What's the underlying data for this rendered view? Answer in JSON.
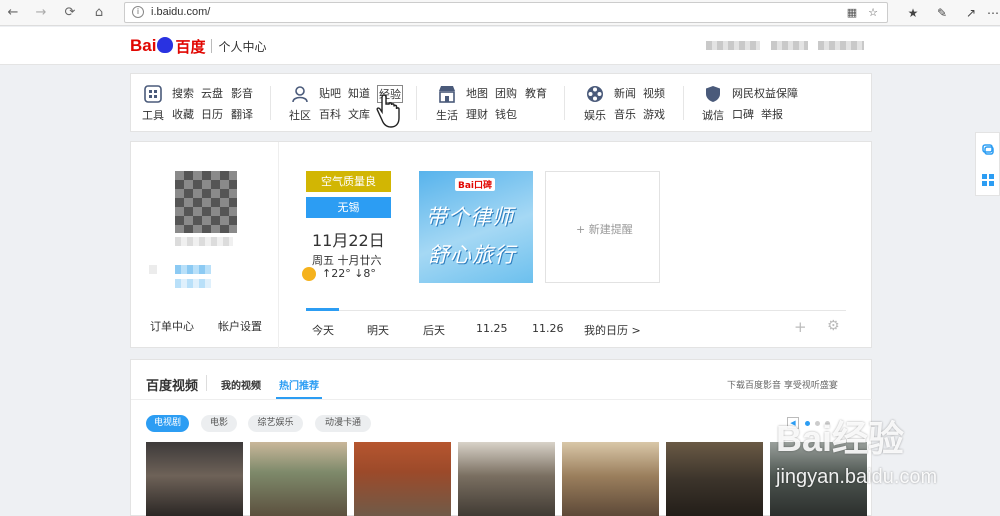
{
  "browser": {
    "url": "i.baidu.com/",
    "icons": [
      "back-icon",
      "forward-icon",
      "refresh-icon",
      "home-icon",
      "info-icon",
      "reading-view-icon",
      "favorite-star-icon",
      "favorites-hub-icon",
      "pen-icon",
      "share-icon",
      "more-icon"
    ]
  },
  "header": {
    "logo_bai": "Bai",
    "logo_du": "du",
    "logo_cn": "百度",
    "subtitle": "个人中心"
  },
  "nav": {
    "groups": [
      {
        "label": "工具",
        "icon": "tools-grid-icon",
        "links": [
          [
            "搜索",
            "云盘",
            "影音"
          ],
          [
            "收藏",
            "日历",
            "翻译"
          ]
        ]
      },
      {
        "label": "社区",
        "icon": "user-community-icon",
        "links": [
          [
            "贴吧",
            "知道",
            "经验"
          ],
          [
            "百科",
            "文库"
          ]
        ]
      },
      {
        "label": "生活",
        "icon": "store-icon",
        "links": [
          [
            "地图",
            "团购",
            "教育"
          ],
          [
            "理财",
            "钱包"
          ]
        ]
      },
      {
        "label": "娱乐",
        "icon": "film-reel-icon",
        "links": [
          [
            "新闻",
            "视频"
          ],
          [
            "音乐",
            "游戏"
          ]
        ]
      },
      {
        "label": "诚信",
        "icon": "shield-icon",
        "links": [
          [
            "网民权益保障"
          ],
          [
            "口碑",
            "举报"
          ]
        ]
      }
    ]
  },
  "profile": {
    "order_center": "订单中心",
    "account_settings": "帐户设置"
  },
  "calendar": {
    "air_quality": "空气质量良",
    "city": "无锡",
    "date": "11月22日",
    "weekday_lunar": "周五  十月廿六",
    "temp": "↑22° ↓8°",
    "ad_brand": "Bai口碑",
    "ad_line1": "带个律师",
    "ad_line2": "舒心旅行",
    "new_reminder": "+ 新建提醒",
    "days": [
      "今天",
      "明天",
      "后天",
      "11.25",
      "11.26",
      "我的日历 >"
    ],
    "active_day": "今天"
  },
  "video": {
    "title": "百度视频",
    "tabs": [
      "我的视频",
      "热门推荐"
    ],
    "active_tab": "热门推荐",
    "download_text": "下载百度影音 享受视听盛宴",
    "categories": [
      "电视剧",
      "电影",
      "综艺娱乐",
      "动漫卡通"
    ],
    "active_category": "电视剧",
    "thumbnails": [
      "thumb-1",
      "thumb-2",
      "thumb-3",
      "thumb-4",
      "thumb-5",
      "thumb-6",
      "thumb-7"
    ]
  },
  "watermark": {
    "logo": "Bai经验",
    "url": "jingyan.baidu.com"
  },
  "colors": {
    "accent": "#2c9df3",
    "brand_red": "#e10601",
    "brand_blue": "#2932e1",
    "air_quality_bg": "#d2b603"
  }
}
